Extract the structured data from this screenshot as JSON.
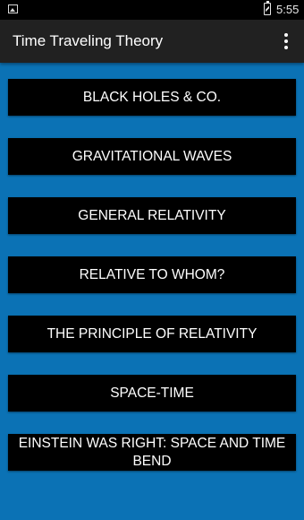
{
  "status_bar": {
    "time": "5:55",
    "icons": [
      "image-notification-icon",
      "battery-charging-icon"
    ]
  },
  "app_bar": {
    "title": "Time Traveling Theory",
    "menu_icon": "overflow-menu-icon"
  },
  "topics": [
    {
      "label": "BLACK HOLES & CO."
    },
    {
      "label": "GRAVITATIONAL WAVES"
    },
    {
      "label": "GENERAL RELATIVITY"
    },
    {
      "label": "RELATIVE TO WHOM?"
    },
    {
      "label": "THE PRINCIPLE OF RELATIVITY"
    },
    {
      "label": "SPACE-TIME"
    },
    {
      "label": "EINSTEIN WAS RIGHT: SPACE AND TIME BEND"
    }
  ],
  "colors": {
    "background": "#0b72b5",
    "app_bar": "#212121",
    "status_bar": "#000000",
    "button": "#000000",
    "button_text": "#ffffff"
  }
}
